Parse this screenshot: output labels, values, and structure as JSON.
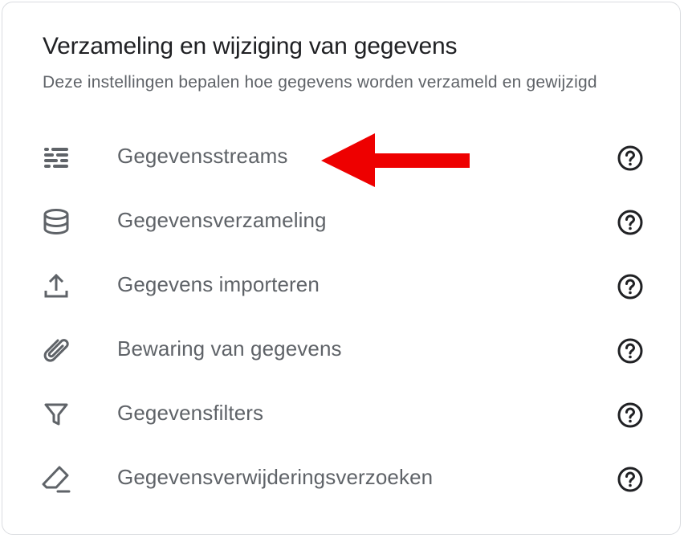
{
  "section": {
    "title": "Verzameling en wijziging van gegevens",
    "subtitle": "Deze instellingen bepalen hoe gegevens worden verzameld en gewijzigd"
  },
  "items": [
    {
      "label": "Gegevensstreams",
      "icon": "streams-icon"
    },
    {
      "label": "Gegevensverzameling",
      "icon": "database-icon"
    },
    {
      "label": "Gegevens importeren",
      "icon": "upload-icon"
    },
    {
      "label": "Bewaring van gegevens",
      "icon": "retention-icon"
    },
    {
      "label": "Gegevensfilters",
      "icon": "filter-icon"
    },
    {
      "label": "Gegevensverwijderingsverzoeken",
      "icon": "eraser-icon"
    }
  ],
  "colors": {
    "icon": "#5f6368",
    "text": "#5f6368",
    "title": "#202124",
    "help": "#202124",
    "annotation_arrow": "#ee0000"
  }
}
